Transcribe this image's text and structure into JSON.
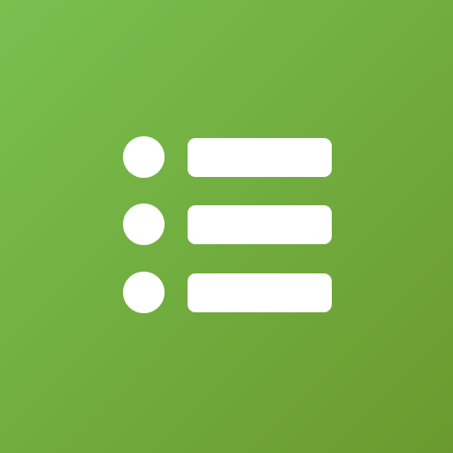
{
  "icon": {
    "name": "list-icon",
    "background_start": "#79C04F",
    "background_end": "#6A9A2F",
    "glyph_color": "#FFFFFF",
    "rows": [
      {
        "bullet": "circle-bullet",
        "line": "text-line-placeholder"
      },
      {
        "bullet": "circle-bullet",
        "line": "text-line-placeholder"
      },
      {
        "bullet": "circle-bullet",
        "line": "text-line-placeholder"
      }
    ]
  }
}
